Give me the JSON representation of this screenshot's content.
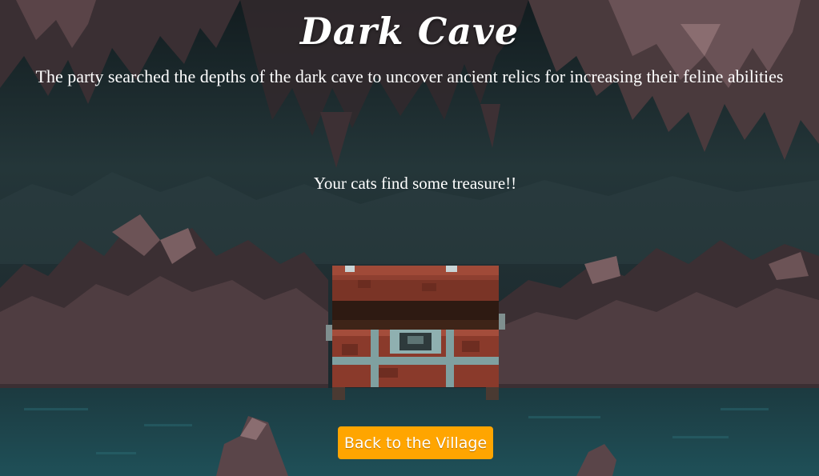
{
  "location": {
    "title": "Dark Cave",
    "description": "The party searched the depths of the dark cave to uncover ancient relics for increasing their feline abilities"
  },
  "result": {
    "message": "Your cats find some treasure!!",
    "reward_icon": "treasure-chest-icon"
  },
  "actions": {
    "back_label": "Back to the Village"
  },
  "colors": {
    "button": "#ffa500",
    "text": "#ffffff",
    "cave_dark": "#1b2a2e",
    "water": "#1f4f55",
    "rock": "#4a3a3d"
  }
}
